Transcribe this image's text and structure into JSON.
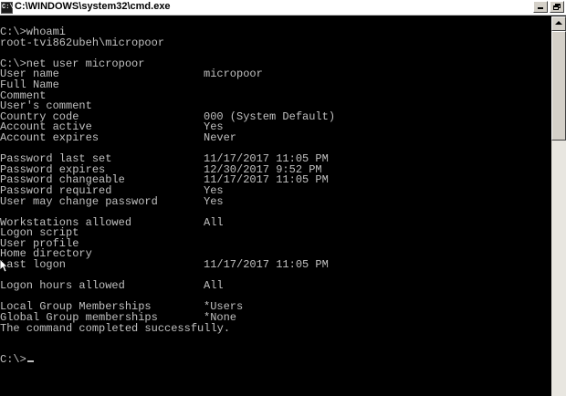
{
  "window": {
    "title": "C:\\WINDOWS\\system32\\cmd.exe",
    "icon_text": "C:\\",
    "buttons": {
      "minimize": "_",
      "restore": "restore",
      "close": "×"
    }
  },
  "console": {
    "lines": [
      {
        "label": "C:\\>whoami",
        "value": ""
      },
      {
        "label": "root-tvi862ubeh\\micropoor",
        "value": ""
      },
      {
        "label": "",
        "value": ""
      },
      {
        "label": "C:\\>net user micropoor",
        "value": ""
      },
      {
        "label": "User name",
        "value": "micropoor"
      },
      {
        "label": "Full Name",
        "value": ""
      },
      {
        "label": "Comment",
        "value": ""
      },
      {
        "label": "User's comment",
        "value": ""
      },
      {
        "label": "Country code",
        "value": "000 (System Default)"
      },
      {
        "label": "Account active",
        "value": "Yes"
      },
      {
        "label": "Account expires",
        "value": "Never"
      },
      {
        "label": "",
        "value": ""
      },
      {
        "label": "Password last set",
        "value": "11/17/2017 11:05 PM"
      },
      {
        "label": "Password expires",
        "value": "12/30/2017 9:52 PM"
      },
      {
        "label": "Password changeable",
        "value": "11/17/2017 11:05 PM"
      },
      {
        "label": "Password required",
        "value": "Yes"
      },
      {
        "label": "User may change password",
        "value": "Yes"
      },
      {
        "label": "",
        "value": ""
      },
      {
        "label": "Workstations allowed",
        "value": "All"
      },
      {
        "label": "Logon script",
        "value": ""
      },
      {
        "label": "User profile",
        "value": ""
      },
      {
        "label": "Home directory",
        "value": ""
      },
      {
        "label": "Last logon",
        "value": "11/17/2017 11:05 PM"
      },
      {
        "label": "",
        "value": ""
      },
      {
        "label": "Logon hours allowed",
        "value": "All"
      },
      {
        "label": "",
        "value": ""
      },
      {
        "label": "Local Group Memberships",
        "value": "*Users"
      },
      {
        "label": "Global Group memberships",
        "value": "*None"
      },
      {
        "label": "The command completed successfully.",
        "value": ""
      },
      {
        "label": "",
        "value": ""
      },
      {
        "label": "",
        "value": ""
      },
      {
        "label": "C:\\>",
        "value": ""
      }
    ]
  },
  "colors": {
    "console_bg": "#000000",
    "console_text": "#c0c0c0",
    "titlebar_bg": "#ffffff"
  }
}
